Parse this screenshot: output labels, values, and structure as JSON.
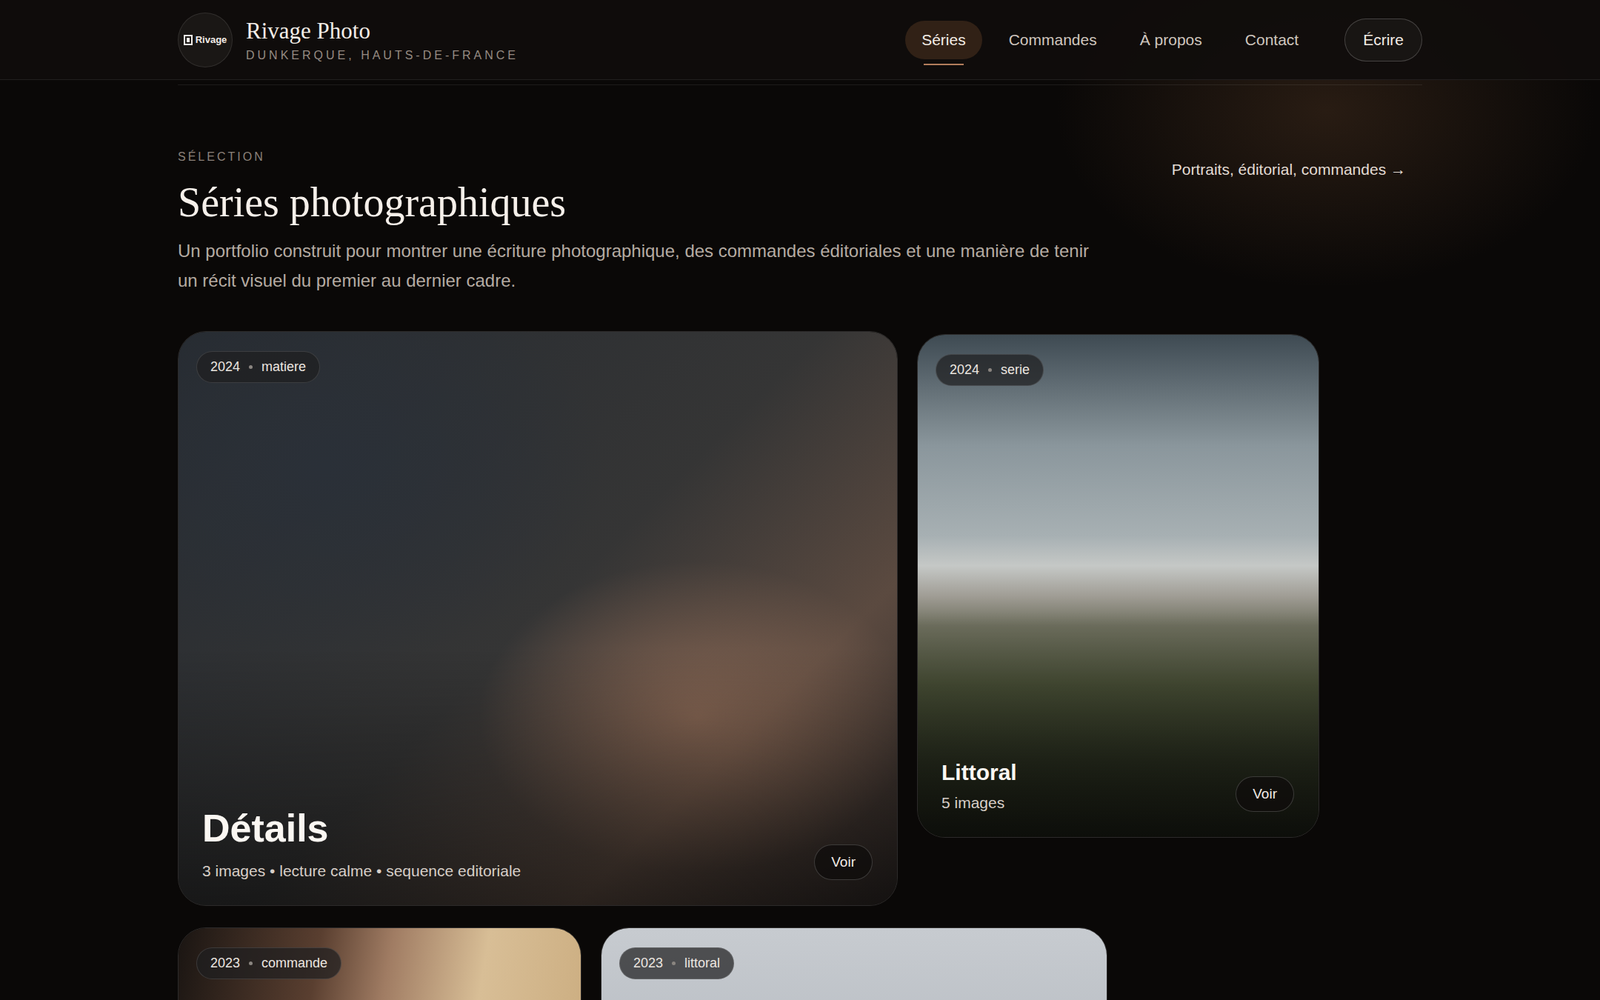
{
  "brand": {
    "logo_text": "Rivage",
    "name": "Rivage Photo",
    "location": "DUNKERQUE, HAUTS-DE-FRANCE"
  },
  "nav": [
    {
      "label": "Séries",
      "selected": true
    },
    {
      "label": "Commandes",
      "selected": false
    },
    {
      "label": "À propos",
      "selected": false
    },
    {
      "label": "Contact",
      "selected": false
    }
  ],
  "cta": "Écrire",
  "section": {
    "eyebrow": "SÉLECTION",
    "title": "Séries photographiques",
    "description": "Un portfolio construit pour montrer une écriture photographique, des commandes éditoriales et une manière de tenir un récit visuel du premier au dernier cadre.",
    "link": "Portraits, éditorial, commandes →"
  },
  "series": [
    {
      "year": "2024",
      "tag": "matiere",
      "title": "Détails",
      "meta": "3 images • lecture calme • sequence editoriale",
      "action": "Voir"
    },
    {
      "year": "2024",
      "tag": "serie",
      "title": "Littoral",
      "meta": "5 images",
      "action": "Voir"
    },
    {
      "year": "2023",
      "tag": "commande"
    },
    {
      "year": "2023",
      "tag": "littoral"
    }
  ]
}
